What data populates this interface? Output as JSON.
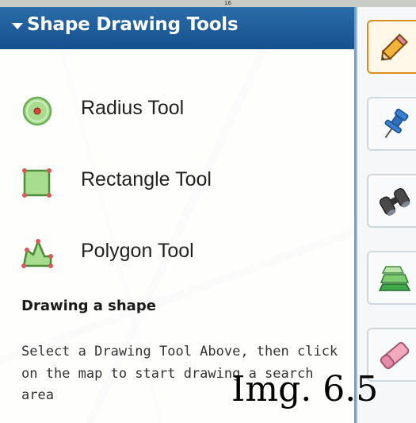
{
  "map": {
    "road_number": "16"
  },
  "panel": {
    "title": "Shape Drawing Tools",
    "tools": [
      {
        "label": "Radius Tool",
        "icon": "radius-circle-icon"
      },
      {
        "label": "Rectangle Tool",
        "icon": "rectangle-shape-icon"
      },
      {
        "label": "Polygon Tool",
        "icon": "polygon-shape-icon"
      }
    ],
    "section_title": "Drawing a shape",
    "description": "Select a Drawing Tool Above, then click on the map to start drawing a search area"
  },
  "toolbar": {
    "buttons": [
      {
        "icon": "pencil-icon",
        "active": true
      },
      {
        "icon": "pushpin-icon",
        "active": false
      },
      {
        "icon": "binoculars-icon",
        "active": false
      },
      {
        "icon": "layers-icon",
        "active": false
      },
      {
        "icon": "eraser-icon",
        "active": false
      }
    ]
  },
  "caption": "Img. 6.5",
  "colors": {
    "header_bg": "#1f5f9e",
    "active_border": "#d98e1e",
    "shape_fill": "#a6dc8c"
  }
}
